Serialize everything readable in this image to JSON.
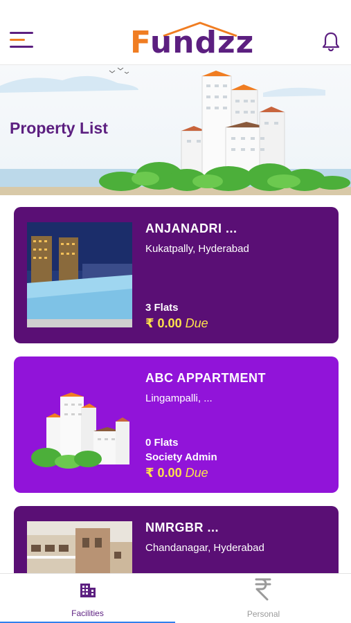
{
  "app": {
    "logo_text_f": "F",
    "logo_text_rest": "undzz"
  },
  "banner": {
    "title": "Property List"
  },
  "properties": [
    {
      "name": "ANJANADRI ...",
      "location": "Kukatpally, Hyderabad",
      "flats": "3 Flats",
      "role": "",
      "currency": "₹",
      "amount": "0.00",
      "due_label": "Due",
      "card_color": "#5a0f75"
    },
    {
      "name": "ABC APPARTMENT",
      "location": "Lingampalli, ...",
      "flats": "0 Flats",
      "role": "Society Admin",
      "currency": "₹",
      "amount": "0.00",
      "due_label": "Due",
      "card_color": "#9114d9"
    },
    {
      "name": "NMRGBR ...",
      "location": "Chandanagar, Hyderabad",
      "card_color": "#5a0f75"
    }
  ],
  "tabs": [
    {
      "label": "Facilities",
      "icon": "building-icon",
      "active": true
    },
    {
      "label": "Personal",
      "icon": "rupee-icon",
      "active": false
    }
  ],
  "colors": {
    "brand_purple": "#5c1f80",
    "brand_orange": "#f07d22",
    "due_yellow": "#fde24c",
    "tab_indicator": "#2f80ed"
  }
}
